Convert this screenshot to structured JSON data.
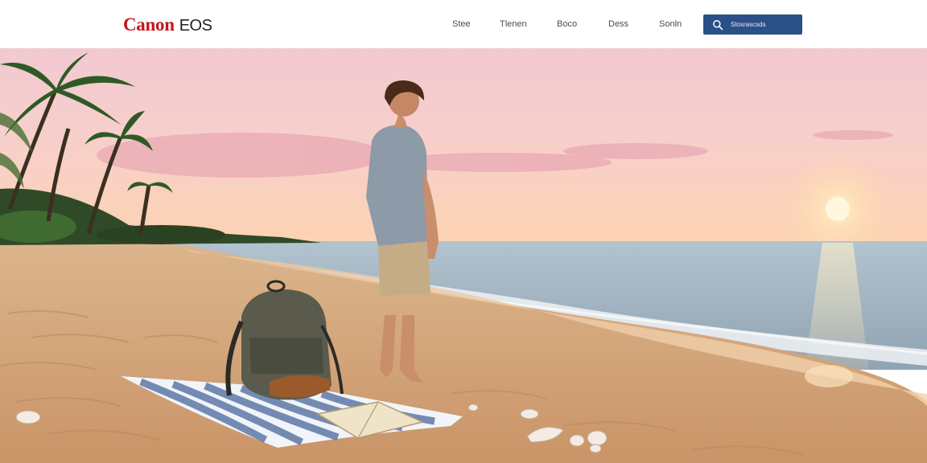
{
  "brand": {
    "name": "Canon",
    "product": "EOS",
    "color": "#c4161c"
  },
  "nav": {
    "items": [
      {
        "label": "Stee"
      },
      {
        "label": "Tlenen"
      },
      {
        "label": "Boco"
      },
      {
        "label": "Dess"
      },
      {
        "label": "Sonln"
      }
    ]
  },
  "search": {
    "placeholder": "Stosrascsds",
    "icon": "search-icon",
    "bg": "#2b4f87"
  },
  "hero": {
    "scene": "beach-sunset",
    "palette": {
      "sky_top": "#f5c8cf",
      "sky_horizon": "#fbd2b3",
      "sea": "#b8c8d2",
      "sand": "#d9ae82",
      "sun": "#fff4d0"
    }
  }
}
